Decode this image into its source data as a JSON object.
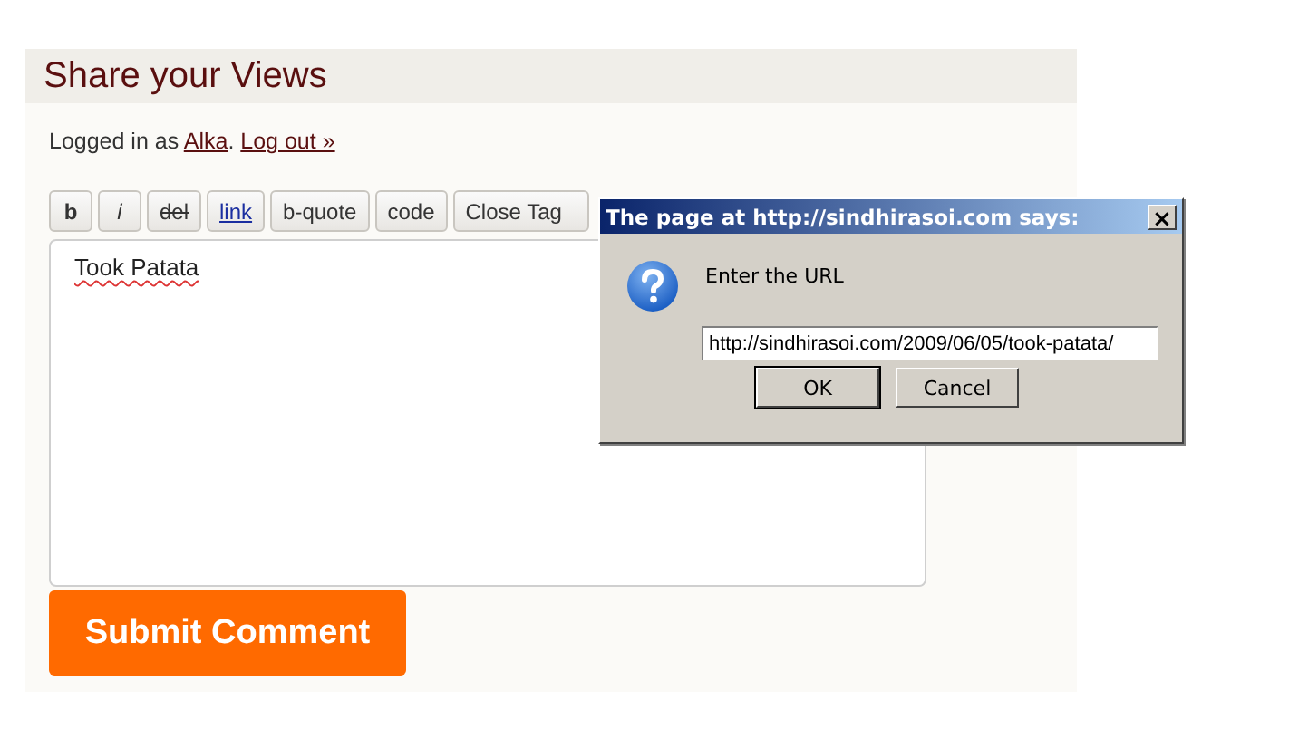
{
  "section": {
    "title": "Share your Views"
  },
  "login": {
    "prefix": "Logged in as ",
    "user": "Alka",
    "separator": ". ",
    "logout": "Log out »"
  },
  "toolbar": [
    {
      "label": "b",
      "kind": "bold"
    },
    {
      "label": "i",
      "kind": "italic"
    },
    {
      "label": "del",
      "kind": "strike"
    },
    {
      "label": "link",
      "kind": "link"
    },
    {
      "label": "b-quote",
      "kind": "plain"
    },
    {
      "label": "code",
      "kind": "plain"
    },
    {
      "label": "Close Tag",
      "kind": "plain"
    }
  ],
  "comment": {
    "value": "Took Patata"
  },
  "submit": {
    "label": "Submit Comment"
  },
  "dialog": {
    "title": "The page at http://sindhirasoi.com says:",
    "close": "×",
    "message": "Enter the URL",
    "value": "http://sindhirasoi.com/2009/06/05/took-patata/",
    "buttons": [
      "OK",
      "Cancel"
    ]
  }
}
